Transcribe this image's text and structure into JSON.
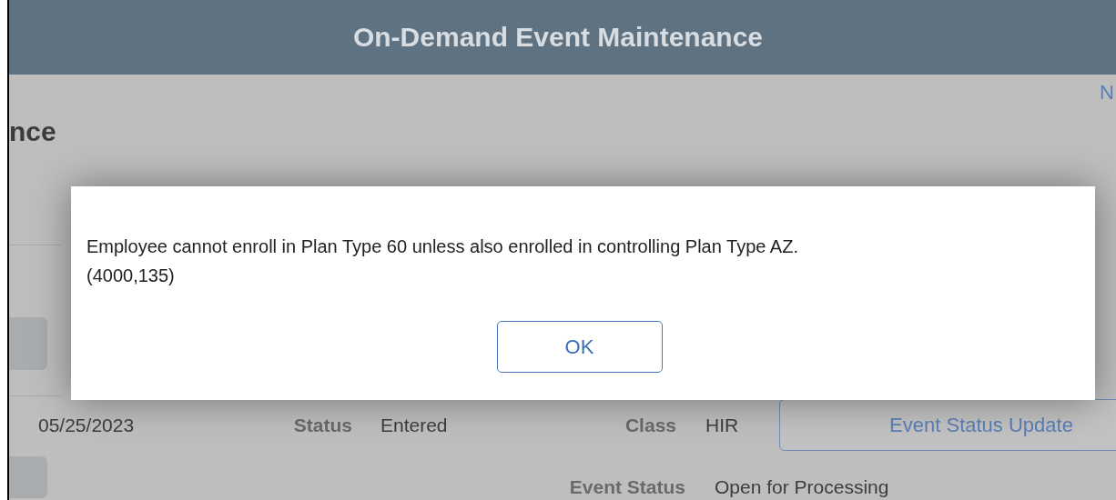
{
  "header": {
    "title": "On-Demand Event Maintenance"
  },
  "top_link": "N",
  "page_heading": "nce",
  "fields": [
    {
      "value": "05/25/2023"
    },
    {
      "label": "Status",
      "value": "Entered"
    },
    {
      "label": "Class",
      "value": "HIR"
    },
    {
      "label": "Event Status",
      "value": "Open for Processing"
    }
  ],
  "event_status_button": "Event Status Update",
  "dialog": {
    "message": "Employee cannot enroll in Plan Type 60 unless also enrolled in controlling Plan Type AZ.",
    "code": "(4000,135)",
    "button": "OK"
  }
}
